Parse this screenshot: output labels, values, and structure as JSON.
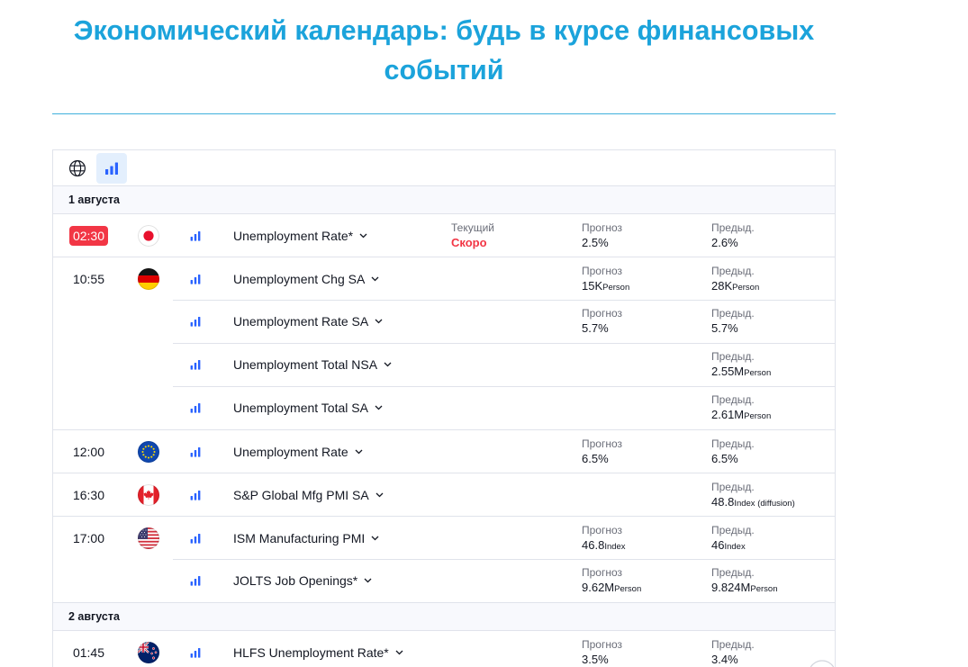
{
  "page": {
    "title": "Экономический календарь: будь в курсе финансовых событий"
  },
  "colors": {
    "title": "#1ba3db",
    "rule": "#3fb0dc",
    "accent": "#2962ff",
    "soon": "#f23645"
  },
  "icons": {
    "country_filter": "globe-icon",
    "importance_filter": "bar-chart-icon",
    "importance": "importance-bars-icon",
    "expand": "chevron-down-icon"
  },
  "toolbar": {
    "importance_filter_active": true
  },
  "labels": {
    "actual": "Текущий",
    "forecast": "Прогноз",
    "previous": "Предыд."
  },
  "days": [
    {
      "date": "1 августа",
      "groups": [
        {
          "time": "02:30",
          "time_highlight": true,
          "flag": "japan-flag-icon",
          "events": [
            {
              "name": "Unemployment Rate*",
              "actual": {
                "value": "Скоро"
              },
              "forecast": {
                "value": "2.5%"
              },
              "previous": {
                "value": "2.6%"
              }
            }
          ]
        },
        {
          "time": "10:55",
          "flag": "germany-flag-icon",
          "events": [
            {
              "name": "Unemployment Chg SA",
              "forecast": {
                "value": "15K",
                "unit": "Person"
              },
              "previous": {
                "value": "28K",
                "unit": "Person"
              }
            },
            {
              "name": "Unemployment Rate SA",
              "forecast": {
                "value": "5.7%"
              },
              "previous": {
                "value": "5.7%"
              }
            },
            {
              "name": "Unemployment Total NSA",
              "previous": {
                "value": "2.55M",
                "unit": "Person"
              }
            },
            {
              "name": "Unemployment Total SA",
              "previous": {
                "value": "2.61M",
                "unit": "Person"
              }
            }
          ]
        },
        {
          "time": "12:00",
          "flag": "eu-flag-icon",
          "events": [
            {
              "name": "Unemployment Rate",
              "forecast": {
                "value": "6.5%"
              },
              "previous": {
                "value": "6.5%"
              }
            }
          ]
        },
        {
          "time": "16:30",
          "flag": "canada-flag-icon",
          "events": [
            {
              "name": "S&P Global Mfg PMI SA",
              "previous": {
                "value": "48.8",
                "unit": "Index (diffusion)"
              }
            }
          ]
        },
        {
          "time": "17:00",
          "flag": "usa-flag-icon",
          "events": [
            {
              "name": "ISM Manufacturing PMI",
              "forecast": {
                "value": "46.8",
                "unit": "Index"
              },
              "previous": {
                "value": "46",
                "unit": "Index"
              }
            },
            {
              "name": "JOLTS Job Openings*",
              "forecast": {
                "value": "9.62M",
                "unit": "Person"
              },
              "previous": {
                "value": "9.824M",
                "unit": "Person"
              }
            }
          ]
        }
      ]
    },
    {
      "date": "2 августа",
      "groups": [
        {
          "time": "01:45",
          "flag": "new-zealand-flag-icon",
          "events": [
            {
              "name": "HLFS Unemployment Rate*",
              "forecast": {
                "value": "3.5%"
              },
              "previous": {
                "value": "3.4%"
              }
            }
          ]
        }
      ]
    }
  ]
}
